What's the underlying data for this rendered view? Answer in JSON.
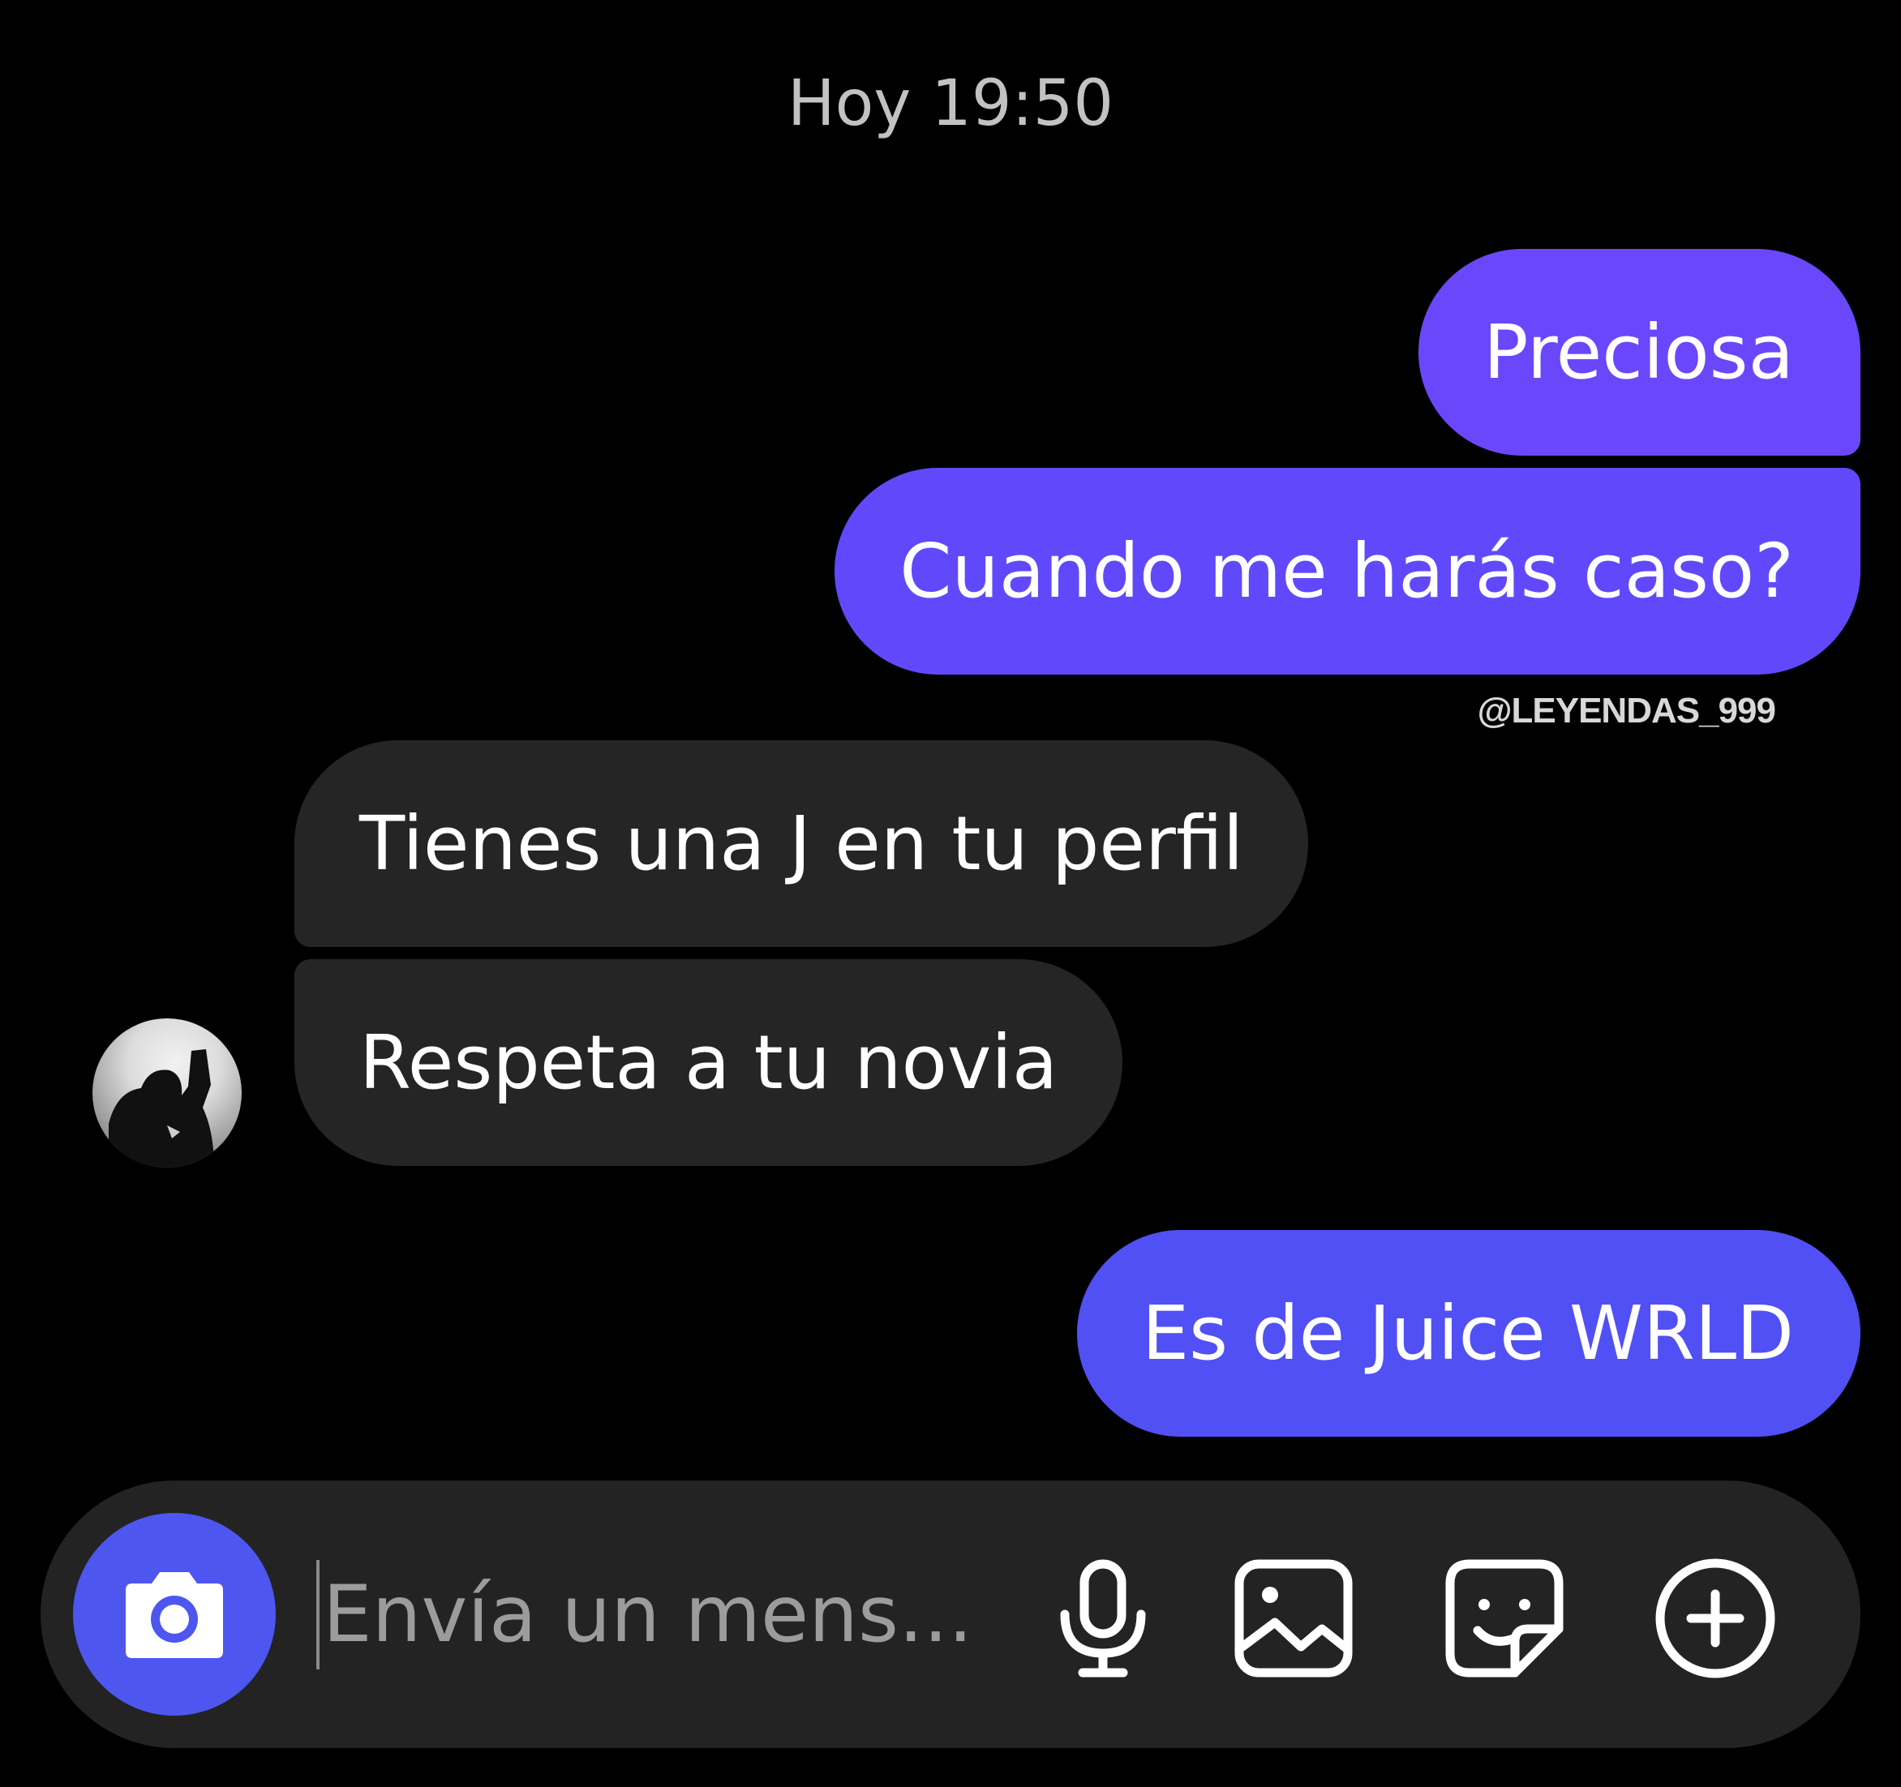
{
  "chat": {
    "timestamp": "Hoy 19:50",
    "watermark": "@LEYENDAS_999",
    "messages": [
      {
        "text": "Preciosa",
        "direction": "outgoing"
      },
      {
        "text": "Cuando me harás caso?",
        "direction": "outgoing"
      },
      {
        "text": "Tienes una J en tu perfil",
        "direction": "incoming"
      },
      {
        "text": "Respeta a tu novia",
        "direction": "incoming"
      },
      {
        "text": "Es de Juice WRLD",
        "direction": "outgoing"
      }
    ]
  },
  "composer": {
    "placeholder": "Envía un mens...",
    "icons": [
      "camera-icon",
      "microphone-icon",
      "image-icon",
      "sticker-icon",
      "plus-icon"
    ]
  },
  "colors": {
    "background": "#000000",
    "outgoing_bubble_top": "#6a47fb",
    "outgoing_bubble_mid": "#6149fb",
    "outgoing_bubble_bottom": "#5150f4",
    "incoming_bubble": "#252525",
    "composer": "#232323",
    "camera_button": "#4e56f0"
  }
}
